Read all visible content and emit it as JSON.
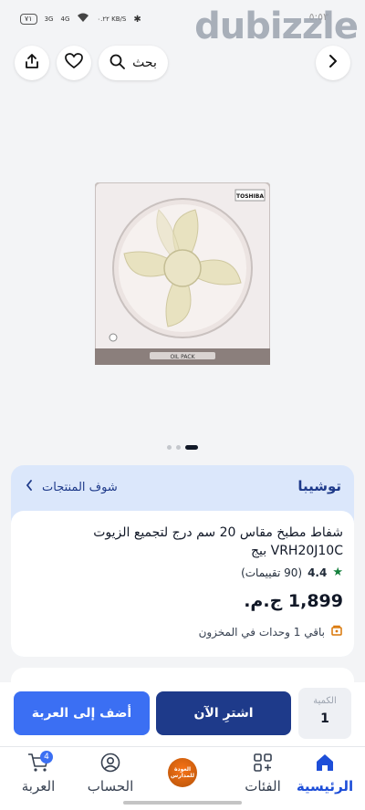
{
  "status_bar": {
    "battery": "٧١",
    "net1": "3G",
    "net2": "4G",
    "speed": "٠.٢٢ KB/S",
    "time": "٥:٥٣"
  },
  "watermark": "dubizzle",
  "header": {
    "search_label": "بحث"
  },
  "carousel": {
    "count": 3,
    "active_index": 2
  },
  "brand": {
    "name": "توشيبا",
    "see_products": "شوف المنتجات"
  },
  "product": {
    "title": "شفاط مطبخ مقاس 20 سم درج لتجميع الزيوت VRH20J10C بيج",
    "rating": "4.4",
    "reviews": "(90 تقييمات)",
    "price": "1,899 ج.م.",
    "stock": "باقي 1 وحدات في المخزون",
    "image_brand": "TOSHIBA",
    "image_label": "OIL PACK"
  },
  "actions": {
    "add_to_cart": "أضف إلى العربة",
    "buy_now": "اشترِ الآن",
    "quantity_label": "الكمية",
    "quantity_value": "1"
  },
  "bottom_nav": {
    "home": "الرئيسية",
    "categories": "الفئات",
    "promo": "العودة للمدارس",
    "account": "الحساب",
    "cart": "العربة",
    "cart_count": "4"
  },
  "colors": {
    "primary": "#3b6ff3",
    "dark": "#1e3a8a",
    "brand_bg": "#dbe7fb",
    "rating_star": "#15803d"
  }
}
